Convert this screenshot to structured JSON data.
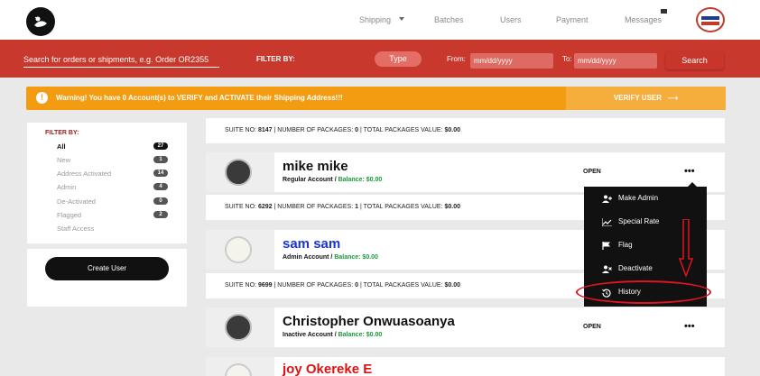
{
  "nav": {
    "items": [
      {
        "label": "Shipping"
      },
      {
        "label": "Batches"
      },
      {
        "label": "Users"
      },
      {
        "label": "Payment"
      },
      {
        "label": "Messages"
      }
    ]
  },
  "search": {
    "placeholder": "Search for orders or shipments, e.g. Order OR2355",
    "filter_by_label": "FILTER BY:",
    "type_label": "Type",
    "from_label": "From:",
    "from_placeholder": "mm/dd/yyyy",
    "to_label": "To:",
    "to_placeholder": "mm/dd/yyyy",
    "search_button": "Search"
  },
  "warning": {
    "icon": "!",
    "text": "Warning! You have 0 Account(s) to VERIFY and ACTIVATE their Shipping Address!!!",
    "button": "VERIFY USER",
    "button_arrow": "⟶"
  },
  "sidebar": {
    "title": "FILTER BY:",
    "items": [
      {
        "label": "All",
        "count": "27"
      },
      {
        "label": "New",
        "count": "1"
      },
      {
        "label": "Address Activated",
        "count": "14"
      },
      {
        "label": "Admin",
        "count": "4"
      },
      {
        "label": "De-Activated",
        "count": "0"
      },
      {
        "label": "Flagged",
        "count": "2"
      },
      {
        "label": "Staff Access",
        "count": ""
      }
    ],
    "create_user": "Create User"
  },
  "suite_rows": [
    {
      "suite_label": "SUITE NO:",
      "suite": "8147",
      "pkg_label": "NUMBER OF PACKAGES:",
      "pkg": "0",
      "val_label": "TOTAL PACKAGES VALUE:",
      "val": "$0.00"
    },
    {
      "suite_label": "SUITE NO:",
      "suite": "6292",
      "pkg_label": "NUMBER OF PACKAGES:",
      "pkg": "1",
      "val_label": "TOTAL PACKAGES VALUE:",
      "val": "$0.00"
    },
    {
      "suite_label": "SUITE NO:",
      "suite": "9699",
      "pkg_label": "NUMBER OF PACKAGES:",
      "pkg": "0",
      "val_label": "TOTAL PACKAGES VALUE:",
      "val": "$0.00"
    }
  ],
  "users": [
    {
      "name": "mike mike",
      "account": "Regular Account /",
      "balance": "Balance: $0.00",
      "status": "OPEN",
      "menu": "•••"
    },
    {
      "name": "sam sam",
      "account": "Admin Account /",
      "balance": "Balance: $0.00",
      "status": "",
      "menu": ""
    },
    {
      "name": "Christopher Onwuasoanya",
      "account": "Inactive Account /",
      "balance": "Balance: $0.00",
      "status": "OPEN",
      "menu": "•••"
    },
    {
      "name": "joy Okereke E",
      "account": "",
      "balance": "",
      "status": "",
      "menu": ""
    }
  ],
  "dropdown": {
    "items": [
      {
        "label": "Make Admin",
        "icon": "user-plus-icon"
      },
      {
        "label": "Special Rate",
        "icon": "line-chart-icon"
      },
      {
        "label": "Flag",
        "icon": "flag-icon"
      },
      {
        "label": "Deactivate",
        "icon": "user-remove-icon"
      },
      {
        "label": "History",
        "icon": "history-icon"
      }
    ]
  },
  "colors": {
    "red_bar": "#c8382d",
    "warning": "#f39c12",
    "balance_green": "#1a9a3a",
    "annotation_red": "#e0141e"
  }
}
